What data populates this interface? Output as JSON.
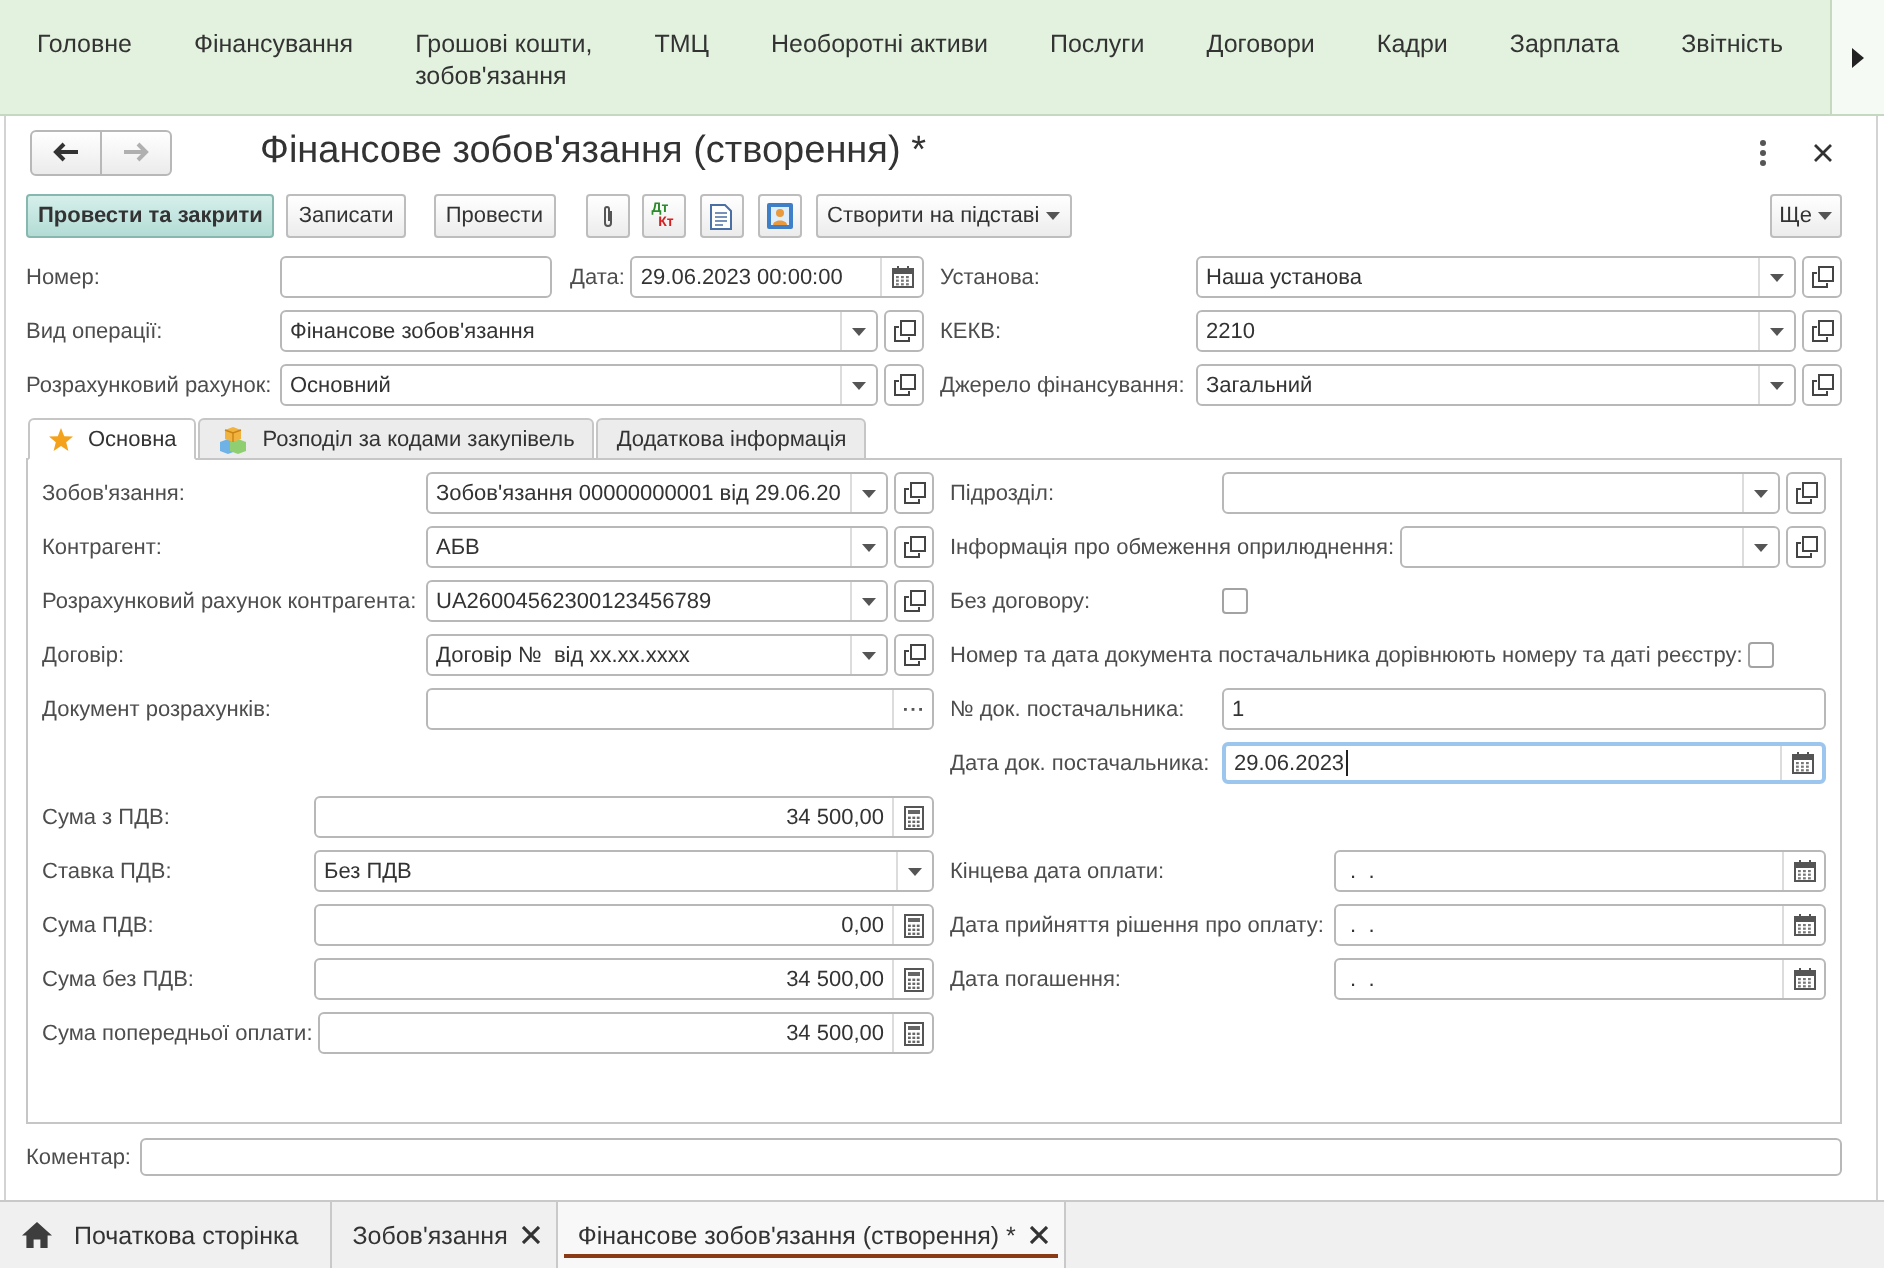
{
  "menu": {
    "items": [
      "Головне",
      "Фінансування",
      "Грошові кошти,\nзобов'язання",
      "ТМЦ",
      "Необоротні активи",
      "Послуги",
      "Договори",
      "Кадри",
      "Зарплата",
      "Звітність"
    ]
  },
  "navigation": [
    {
      "kind": "back",
      "disabled": false
    },
    {
      "kind": "forward",
      "disabled": true
    }
  ],
  "window": {
    "title": "Фінансове зобов'язання (створення) *"
  },
  "toolbar": {
    "buttons": [
      {
        "kind": "default",
        "label": "Провести та закрити"
      },
      {
        "kind": "plain",
        "label": "Записати"
      },
      {
        "kind": "plain",
        "label": "Провести"
      },
      {
        "kind": "attach"
      },
      {
        "kind": "postings",
        "top": "Дт",
        "bottom": "Кт"
      },
      {
        "kind": "print"
      },
      {
        "kind": "contacts"
      },
      {
        "kind": "menu",
        "label": "Створити на підставі"
      }
    ],
    "more": "Ще"
  },
  "header": {
    "rows": [
      {
        "left": [
          {
            "label": "Номер:",
            "kind": "input"
          },
          {
            "label": "Дата:",
            "kind": "date",
            "value": "29.06.2023 00:00:00"
          }
        ],
        "right": {
          "label": "Установа:",
          "kind": "select",
          "value": "Наша установа"
        }
      },
      {
        "left": [
          {
            "label": "Вид операції:",
            "kind": "select",
            "value": "Фінансове зобов'язання"
          }
        ],
        "right": {
          "label": "КЕКВ:",
          "kind": "select",
          "value": "2210"
        }
      },
      {
        "left": [
          {
            "label": "Розрахунковий рахунок:",
            "kind": "select",
            "value": "Основний"
          }
        ],
        "right": {
          "label": "Джерело фінансування:",
          "kind": "select",
          "value": "Загальний"
        }
      }
    ]
  },
  "tabs": [
    {
      "label": "Основна",
      "selected": true
    },
    {
      "label": "Розподіл за кодами закупівель",
      "selected": false
    },
    {
      "label": "Додаткова інформація",
      "selected": false
    }
  ],
  "panel": {
    "left": [
      {
        "fields": [
          {
            "label": "Зобов'язання:",
            "kind": "select",
            "value": "Зобов'язання 00000000001 від 29.06.20",
            "focused": false
          },
          {
            "label": "Контрагент:",
            "kind": "select",
            "value": "АБВ",
            "focused": false
          },
          {
            "label": "Розрахунковий рахунок контрагента:",
            "kind": "select",
            "value": "UA26004562300123456789",
            "focused": false
          },
          {
            "label": "Договір:",
            "kind": "select",
            "value": "Договір №  від xx.xx.xxxx",
            "focused": false
          },
          {
            "label": "Документ розрахунків:",
            "kind": "pick",
            "focused": false
          }
        ]
      },
      {
        "fields": [
          {
            "label": "Сума з ПДВ:",
            "kind": "amount",
            "value": "34 500,00",
            "focused": false
          },
          {
            "label": "Ставка ПДВ:",
            "kind": "choice",
            "value": "Без ПДВ",
            "focused": false
          },
          {
            "label": "Сума ПДВ:",
            "kind": "amount",
            "value": "0,00",
            "focused": false
          },
          {
            "label": "Сума без ПДВ:",
            "kind": "amount",
            "value": "34 500,00",
            "focused": false
          },
          {
            "label": "Сума попередньої оплати:",
            "kind": "amount",
            "value": "34 500,00",
            "focused": false
          }
        ]
      }
    ],
    "right": [
      {
        "fields": [
          {
            "label": "Підрозділ:",
            "kind": "select",
            "focused": false
          },
          {
            "label": "Інформація про обмеження оприлюднення:",
            "kind": "select",
            "focused": false
          },
          {
            "label": "Без договору:",
            "kind": "checkbox",
            "checked": false,
            "focused": false
          },
          {
            "label": "Номер та дата документа постачальника дорівнюють номеру та даті реєстру:",
            "kind": "checkbox",
            "checked": false,
            "focused": false
          },
          {
            "label": "№ док. постачальника:",
            "kind": "input",
            "value": "1",
            "focused": false
          },
          {
            "label": "Дата док. постачальника:",
            "kind": "date",
            "value": "29.06.2023",
            "focused": true
          }
        ]
      },
      {
        "fields": [
          {
            "label": "Кінцева дата оплати:",
            "kind": "date",
            "value": " .  .",
            "focused": false
          },
          {
            "label": "Дата прийняття рішення про оплату:",
            "kind": "date",
            "value": " .  .",
            "focused": false
          },
          {
            "label": "Дата погашення:",
            "kind": "date",
            "value": " .  .",
            "focused": false
          }
        ]
      }
    ]
  },
  "comment": {
    "label": "Коментар:"
  },
  "open_tabs": [
    {
      "kind": "home",
      "label": "Початкова сторінка",
      "selected": false
    },
    {
      "kind": "page",
      "label": "Зобов'язання",
      "selected": false
    },
    {
      "kind": "page",
      "label": "Фінансове зобов'язання (створення) *",
      "selected": true
    }
  ]
}
